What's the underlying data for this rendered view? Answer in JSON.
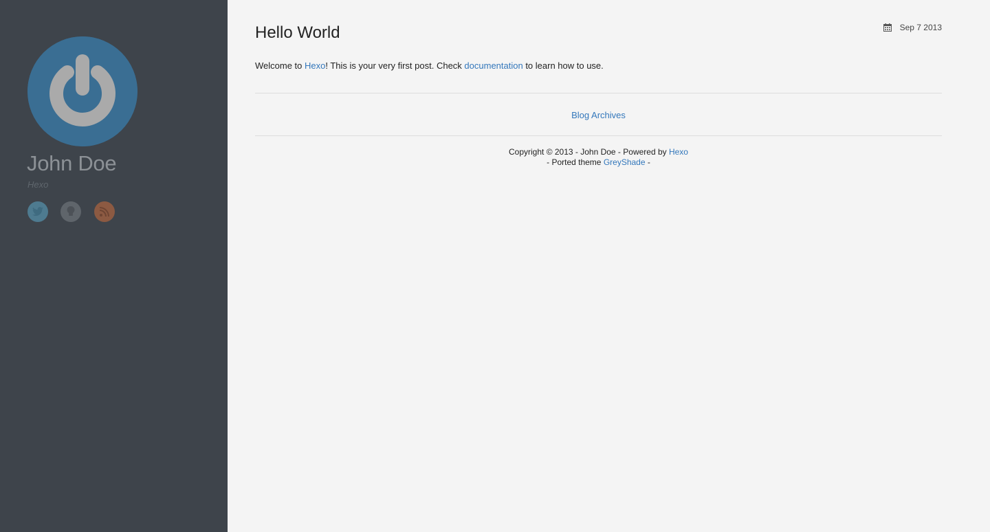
{
  "sidebar": {
    "author_name": "John Doe",
    "tagline": "Hexo",
    "social": [
      {
        "name": "twitter",
        "icon": "twitter-icon",
        "color": "#4e7b90"
      },
      {
        "name": "github",
        "icon": "github-icon",
        "color": "#5f656b"
      },
      {
        "name": "rss",
        "icon": "rss-icon",
        "color": "#8c5a42"
      }
    ]
  },
  "post": {
    "title": "Hello World",
    "date": "Sep 7 2013",
    "body_prefix": "Welcome to ",
    "body_link1": "Hexo",
    "body_middle": "! This is your very first post. Check ",
    "body_link2": "documentation",
    "body_suffix": " to learn how to use."
  },
  "nav": {
    "archives_label": "Blog Archives"
  },
  "footer": {
    "line1_prefix": "Copyright © 2013 - John Doe - Powered by ",
    "line1_link": "Hexo",
    "line2_prefix": "- Ported theme ",
    "line2_link": "GreyShade",
    "line2_suffix": " -"
  },
  "colors": {
    "sidebar_bg": "#3e444b",
    "main_bg": "#f4f4f4",
    "link": "#3377bb",
    "avatar_bg": "#3a6e93"
  }
}
